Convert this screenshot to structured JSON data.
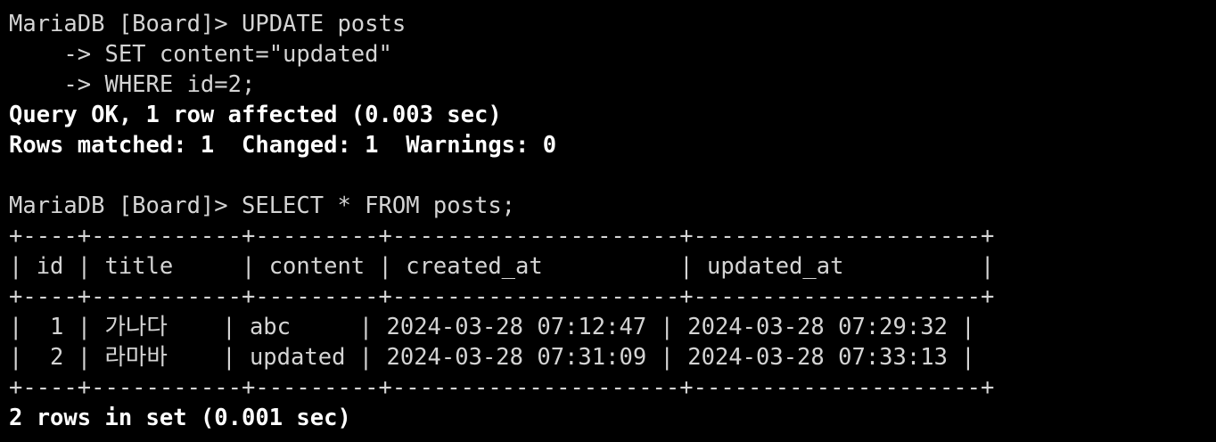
{
  "terminal": {
    "colors": {
      "background": "#000000",
      "text": "#d4d4d4",
      "bold_text": "#ffffff"
    },
    "lines": [
      "MariaDB [Board]> UPDATE posts",
      "    -> SET content=\"updated\"",
      "    -> WHERE id=2;",
      "Query OK, 1 row affected (0.003 sec)",
      "Rows matched: 1  Changed: 1  Warnings: 0",
      "",
      "MariaDB [Board]> SELECT * FROM posts;",
      "+----+-----------+---------+---------------------+---------------------+",
      "| id | title     | content | created_at          | updated_at          |",
      "+----+-----------+---------+---------------------+---------------------+",
      "|  1 | 가나다    | abc     | 2024-03-28 07:12:47 | 2024-03-28 07:29:32 |",
      "|  2 | 라마바    | updated | 2024-03-28 07:31:09 | 2024-03-28 07:33:13 |",
      "+----+-----------+---------+---------------------+---------------------+",
      "2 rows in set (0.001 sec)"
    ]
  }
}
